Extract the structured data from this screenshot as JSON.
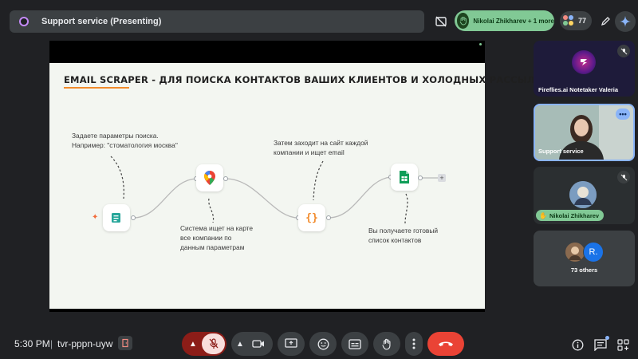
{
  "topbar": {
    "meeting_title": "Support service (Presenting)",
    "raised_hand_text": "Nikolai Zhikharev + 1 more",
    "participant_count": "77"
  },
  "slide": {
    "title": "EMAIL SCRAPER - ДЛЯ ПОИСКА КОНТАКТОВ ВАШИХ КЛИЕНТОВ И ХОЛОДНЫХ РАССЫЛОК",
    "step1_lines": [
      "Задаете параметры поиска.",
      "Например: \"стоматология москва\""
    ],
    "step2_lines": [
      "Система ищет на карте",
      "все компании по",
      "данным параметрам"
    ],
    "step3_lines": [
      "Затем заходит на сайт каждой",
      "компании и ищет email"
    ],
    "step4_lines": [
      "Вы получаете готовый",
      "список контактов"
    ],
    "code_node_symbol": "{}"
  },
  "tiles": [
    {
      "name": "Fireflies.ai Notetaker Valeria",
      "muted": true
    },
    {
      "name": "Support service",
      "muted": false
    },
    {
      "name": "Nikolai Zhikharev",
      "muted": true
    },
    {
      "name": "73 others",
      "avatar_letter": "R."
    }
  ],
  "bottombar": {
    "time": "5:30 PM",
    "separator": "|",
    "meeting_code": "tvr-pppn-uyw"
  },
  "colors": {
    "background": "#202124",
    "accent_green": "#81c995",
    "end_call_red": "#ea4335",
    "title_underline": "#f28b2c"
  }
}
